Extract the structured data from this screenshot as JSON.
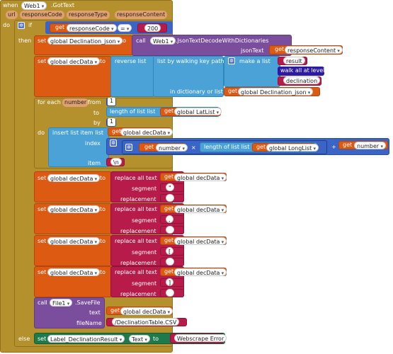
{
  "event": {
    "when": "when",
    "component": "Web1",
    "event": ".GotText",
    "params": [
      "url",
      "responseCode",
      "responseType",
      "responseContent"
    ]
  },
  "ifblock": {
    "do": "do",
    "if": "if",
    "then": "then",
    "else": "else",
    "get_label": "get",
    "var": "responseCode",
    "op": "=",
    "value": "200"
  },
  "set1": {
    "set": "set",
    "var": "global Declination_json",
    "to": "to",
    "call": "call",
    "component": "Web1",
    "method": ".JsonTextDecodeWithDictionaries",
    "arg_label": "jsonText",
    "get_label": "get",
    "arg_var": "responseContent"
  },
  "set2": {
    "set": "set",
    "var": "global decData",
    "to": "to",
    "reverse": "reverse list",
    "walk": "list by walking key path",
    "make_list": "make a list",
    "items": [
      "result",
      "walk all at level",
      "declination"
    ],
    "in_dict": "in dictionary or list",
    "get_label": "get",
    "dict_var": "global Declination_json"
  },
  "foreach": {
    "label": "for each",
    "var": "number",
    "from": "from",
    "from_val": "1",
    "to": "to",
    "to_expr": "length of list  list",
    "get_label": "get",
    "to_var": "global LatList",
    "by": "by",
    "by_val": "1",
    "do": "do"
  },
  "insert": {
    "label": "insert list item  list",
    "get_label": "get",
    "list_var": "global decData",
    "index": "index",
    "get_num": "number",
    "times": "×",
    "len_label": "length of list  list",
    "len_var": "global LongList",
    "plus": "+",
    "get_num2": "number",
    "item": "item",
    "item_val": "\\n"
  },
  "replaces": [
    {
      "set": "set",
      "var": "global decData",
      "to": "to",
      "replace": "replace all text",
      "get_label": "get",
      "src": "global decData",
      "segment": "segment",
      "seg_val": "\"",
      "replacement": "replacement",
      "rep_val": ""
    },
    {
      "set": "set",
      "var": "global decData",
      "to": "to",
      "replace": "replace all text",
      "get_label": "get",
      "src": "global decData",
      "segment": "segment",
      "seg_val": ",",
      "replacement": "replacement",
      "rep_val": ""
    },
    {
      "set": "set",
      "var": "global decData",
      "to": "to",
      "replace": "replace all text",
      "get_label": "get",
      "src": "global decData",
      "segment": "segment",
      "seg_val": "[",
      "replacement": "replacement",
      "rep_val": ""
    },
    {
      "set": "set",
      "var": "global decData",
      "to": "to",
      "replace": "replace all text",
      "get_label": "get",
      "src": "global decData",
      "segment": "segment",
      "seg_val": "]",
      "replacement": "replacement",
      "rep_val": ""
    }
  ],
  "savefile": {
    "call": "call",
    "component": "File1",
    "method": ".SaveFile",
    "text": "text",
    "get_label": "get",
    "text_var": "global decData",
    "filename": "fileName",
    "filename_val": "/DeclinationTable.CSV"
  },
  "elseset": {
    "set": "set",
    "component": "Label_DeclinationResult",
    "prop": "Text",
    "to": "to",
    "value": "Webscrape Error"
  }
}
